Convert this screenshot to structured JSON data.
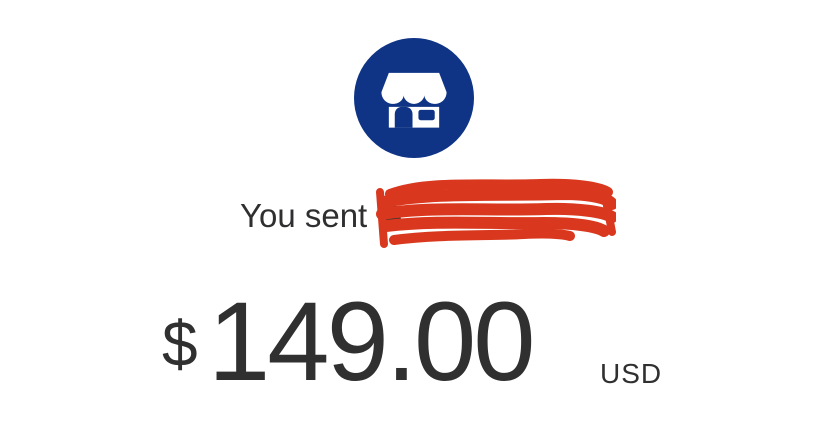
{
  "merchant": {
    "icon": "storefront-icon",
    "avatar_color": "#0f3485"
  },
  "transaction": {
    "prefix": "You sent",
    "recipient_visible": "A",
    "amount": "149.00",
    "currency_symbol": "$",
    "currency_code": "USD",
    "redaction_color": "#d9381e"
  }
}
